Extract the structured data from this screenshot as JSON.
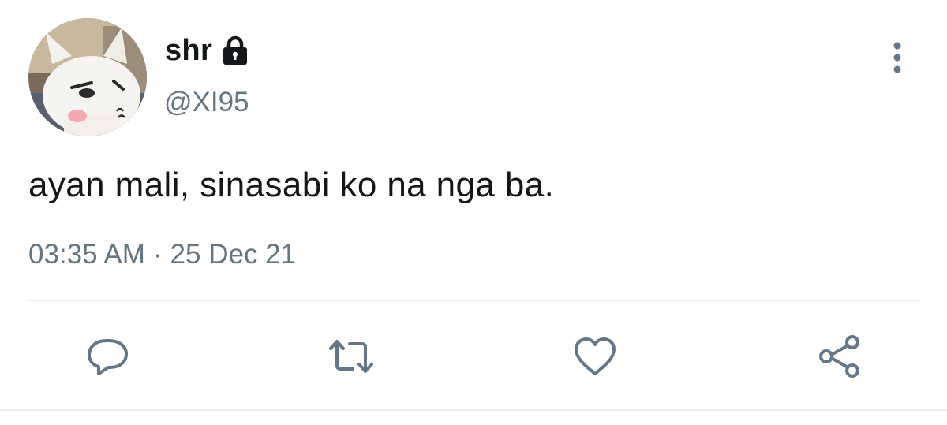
{
  "user": {
    "display_name": "shr",
    "handle": "@XI95",
    "protected_icon": "lock-icon",
    "avatar": "avatar-image"
  },
  "tweet": {
    "text": "ayan mali, sinasabi ko na nga ba.",
    "time": "03:35 AM",
    "separator": "·",
    "date": "25 Dec 21"
  },
  "actions": [
    {
      "name": "reply",
      "icon": "comment-icon"
    },
    {
      "name": "retweet",
      "icon": "retweet-icon"
    },
    {
      "name": "like",
      "icon": "heart-icon"
    },
    {
      "name": "share",
      "icon": "share-icon"
    }
  ],
  "menu": {
    "icon": "more-vertical-icon"
  },
  "colors": {
    "primary_text": "#14171a",
    "secondary_text": "#66757f",
    "icon": "#657786",
    "divider": "#e6ecf0"
  }
}
